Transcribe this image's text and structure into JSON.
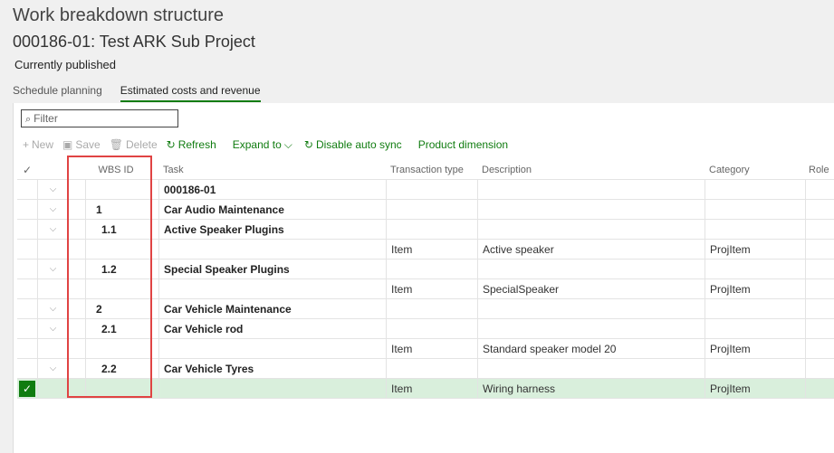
{
  "page": {
    "title": "Work breakdown structure",
    "subtitle": "000186-01: Test ARK Sub Project",
    "status": "Currently published"
  },
  "tabs": [
    {
      "label": "Schedule planning",
      "active": false
    },
    {
      "label": "Estimated costs and revenue",
      "active": true
    }
  ],
  "filter": {
    "placeholder": "Filter"
  },
  "toolbar": {
    "new": "New",
    "save": "Save",
    "delete": "Delete",
    "refresh": "Refresh",
    "expand": "Expand to",
    "disable_sync": "Disable auto sync",
    "product_dimension": "Product dimension"
  },
  "columns": {
    "wbs_id": "WBS ID",
    "task": "Task",
    "transaction_type": "Transaction type",
    "description": "Description",
    "category": "Category",
    "role": "Role"
  },
  "rows": [
    {
      "wbs": "",
      "task": "000186-01",
      "tt": "",
      "desc": "",
      "cat": "",
      "level": 0,
      "expander": true,
      "selected": false
    },
    {
      "wbs": "1",
      "task": "Car Audio Maintenance",
      "tt": "",
      "desc": "",
      "cat": "",
      "level": 1,
      "expander": true,
      "selected": false
    },
    {
      "wbs": "1.1",
      "task": "Active Speaker Plugins",
      "tt": "",
      "desc": "",
      "cat": "",
      "level": 2,
      "expander": true,
      "selected": false
    },
    {
      "wbs": "",
      "task": "",
      "tt": "Item",
      "desc": "Active speaker",
      "cat": "ProjItem",
      "level": 0,
      "expander": false,
      "selected": false
    },
    {
      "wbs": "1.2",
      "task": "Special Speaker Plugins",
      "tt": "",
      "desc": "",
      "cat": "",
      "level": 2,
      "expander": true,
      "selected": false
    },
    {
      "wbs": "",
      "task": "",
      "tt": "Item",
      "desc": "SpecialSpeaker",
      "cat": "ProjItem",
      "level": 0,
      "expander": false,
      "selected": false
    },
    {
      "wbs": "2",
      "task": "Car Vehicle Maintenance",
      "tt": "",
      "desc": "",
      "cat": "",
      "level": 1,
      "expander": true,
      "selected": false
    },
    {
      "wbs": "2.1",
      "task": "Car Vehicle rod",
      "tt": "",
      "desc": "",
      "cat": "",
      "level": 2,
      "expander": true,
      "selected": false
    },
    {
      "wbs": "",
      "task": "",
      "tt": "Item",
      "desc": "Standard speaker model 20",
      "cat": "ProjItem",
      "level": 0,
      "expander": false,
      "selected": false
    },
    {
      "wbs": "2.2",
      "task": "Car Vehicle Tyres",
      "tt": "",
      "desc": "",
      "cat": "",
      "level": 2,
      "expander": true,
      "selected": false
    },
    {
      "wbs": "",
      "task": "",
      "tt": "Item",
      "desc": "Wiring harness",
      "cat": "ProjItem",
      "level": 0,
      "expander": false,
      "selected": true
    }
  ],
  "colors": {
    "accent": "#107c10",
    "highlight": "#e04343",
    "selected_row": "#d9efdc"
  }
}
